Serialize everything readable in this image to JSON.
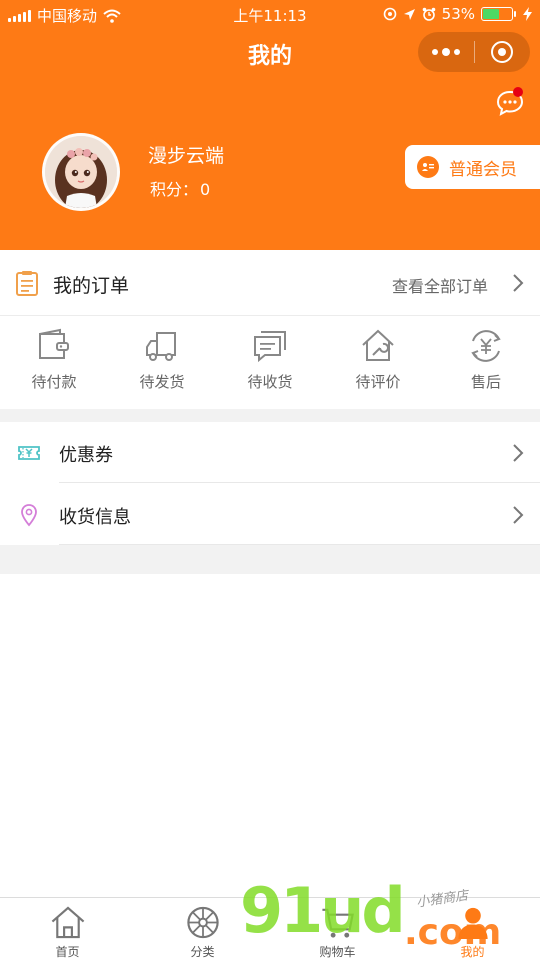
{
  "colors": {
    "accent": "#fe7a15",
    "badge_red": "#e60012",
    "battery_green": "#4cd964"
  },
  "status_bar": {
    "carrier": "中国移动",
    "time": "上午11:13",
    "battery": "53%",
    "icons": [
      "signal-icon",
      "wifi-icon",
      "location-lock-icon",
      "location-arrow-icon",
      "alarm-icon",
      "battery-icon",
      "charging-icon"
    ]
  },
  "nav": {
    "title": "我的",
    "capsule_icons": [
      "more-icon",
      "close-icon"
    ]
  },
  "profile": {
    "username": "漫步云端",
    "points_label": "积分：",
    "points_value": "0",
    "member_label": "普通会员",
    "message_icon": "chat-bubble-icon"
  },
  "orders": {
    "title": "我的订单",
    "view_all": "查看全部订单",
    "items": [
      {
        "label": "待付款",
        "icon": "wallet-icon"
      },
      {
        "label": "待发货",
        "icon": "truck-icon"
      },
      {
        "label": "待收货",
        "icon": "message-box-icon"
      },
      {
        "label": "待评价",
        "icon": "house-wrench-icon"
      },
      {
        "label": "售后",
        "icon": "refund-icon"
      }
    ]
  },
  "menu": [
    {
      "label": "优惠券",
      "icon": "coupon-icon"
    },
    {
      "label": "收货信息",
      "icon": "location-pin-icon"
    }
  ],
  "tabbar": [
    {
      "label": "首页",
      "icon": "home-icon",
      "active": false
    },
    {
      "label": "分类",
      "icon": "category-wheel-icon",
      "active": false
    },
    {
      "label": "购物车",
      "icon": "cart-icon",
      "active": false
    },
    {
      "label": "我的",
      "icon": "user-icon",
      "active": true
    }
  ],
  "watermark": {
    "main": "91ud",
    "suffix": ".com",
    "tagline": "小猪商店"
  }
}
